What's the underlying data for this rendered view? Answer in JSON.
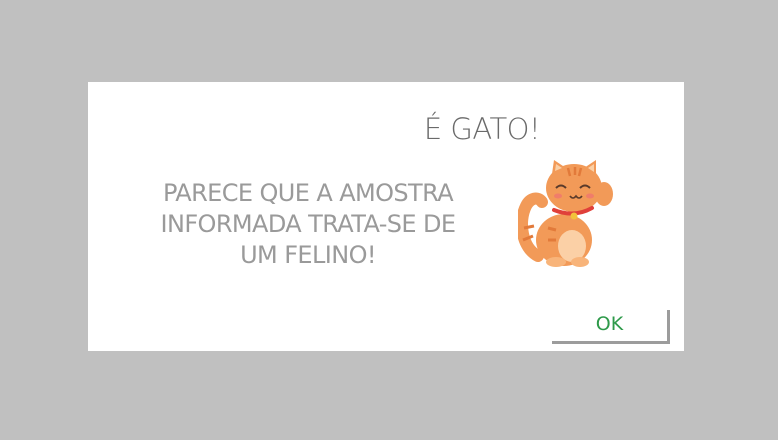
{
  "dialog": {
    "title": "É GATO!",
    "message": "PARECE QUE A AMOSTRA INFORMADA TRATA-SE DE UM FELINO!",
    "ok_label": "OK",
    "illustration": "cat-icon"
  },
  "colors": {
    "overlay": "#c0c0c0",
    "title_text": "#6a6a6a",
    "message_text": "#9a9a9a",
    "ok_text": "#2e9a4a",
    "cat_orange": "#f29a58"
  }
}
